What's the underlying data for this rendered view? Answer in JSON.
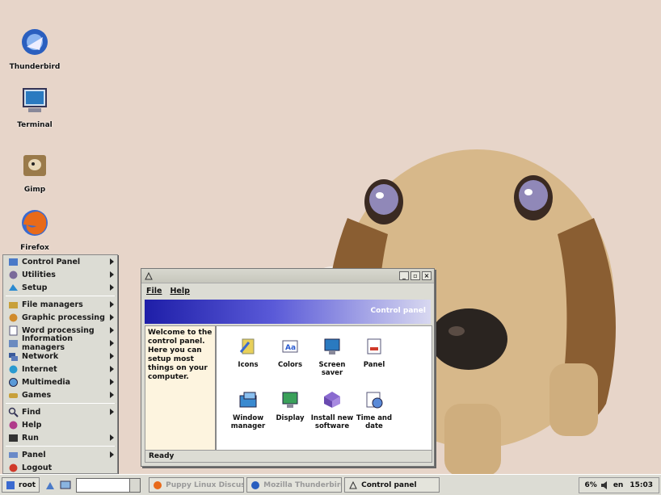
{
  "desktop": {
    "icons": [
      {
        "label": "Thunderbird",
        "icon": "thunderbird-icon"
      },
      {
        "label": "Terminal",
        "icon": "terminal-icon"
      },
      {
        "label": "Gimp",
        "icon": "gimp-icon"
      },
      {
        "label": "Firefox",
        "icon": "firefox-icon"
      }
    ]
  },
  "start_menu": {
    "items": [
      {
        "label": "Control Panel",
        "icon": "control-panel-icon",
        "submenu": true
      },
      {
        "label": "Utilities",
        "icon": "utilities-icon",
        "submenu": true
      },
      {
        "label": "Setup",
        "icon": "setup-icon",
        "submenu": true
      },
      {
        "label": "File managers",
        "icon": "file-managers-icon",
        "submenu": true
      },
      {
        "label": "Graphic processing",
        "icon": "graphic-processing-icon",
        "submenu": true
      },
      {
        "label": "Word processing",
        "icon": "word-processing-icon",
        "submenu": true
      },
      {
        "label": "Information managers",
        "icon": "information-managers-icon",
        "submenu": true
      },
      {
        "label": "Network",
        "icon": "network-icon",
        "submenu": true
      },
      {
        "label": "Internet",
        "icon": "internet-icon",
        "submenu": true
      },
      {
        "label": "Multimedia",
        "icon": "multimedia-icon",
        "submenu": true
      },
      {
        "label": "Games",
        "icon": "games-icon",
        "submenu": true
      },
      {
        "label": "Find",
        "icon": "find-icon",
        "submenu": true
      },
      {
        "label": "Help",
        "icon": "help-icon",
        "submenu": false
      },
      {
        "label": "Run",
        "icon": "run-icon",
        "submenu": true
      },
      {
        "label": "Panel",
        "icon": "panel-icon",
        "submenu": true
      },
      {
        "label": "Logout",
        "icon": "logout-icon",
        "submenu": false
      }
    ]
  },
  "control_panel": {
    "menu": [
      "File",
      "Help"
    ],
    "banner_title": "Control panel",
    "welcome_text": "Welcome to the control panel. Here you can setup most things on your computer.",
    "items": [
      {
        "label": "Icons",
        "icon": "icons-icon"
      },
      {
        "label": "Colors",
        "icon": "colors-icon"
      },
      {
        "label": "Screen saver",
        "icon": "screen-saver-icon"
      },
      {
        "label": "Panel",
        "icon": "panel-settings-icon"
      },
      {
        "label": "Window manager",
        "icon": "window-manager-icon"
      },
      {
        "label": "Display",
        "icon": "display-icon"
      },
      {
        "label": "Install new software",
        "icon": "install-software-icon"
      },
      {
        "label": "Time and date",
        "icon": "time-date-icon"
      }
    ],
    "status": "Ready"
  },
  "taskbar": {
    "start_label": "root",
    "tasks": [
      {
        "label": "Puppy Linux Discuss",
        "active": false
      },
      {
        "label": "Mozilla Thunderbird",
        "active": false
      },
      {
        "label": "Control panel",
        "active": true
      }
    ],
    "cpu": "6%",
    "language": "en",
    "clock": "15:03"
  },
  "colors": {
    "desktop_bg": "#e7d5c9",
    "banner_start": "#1e1ea8",
    "welcome_bg": "#fdf4df"
  }
}
